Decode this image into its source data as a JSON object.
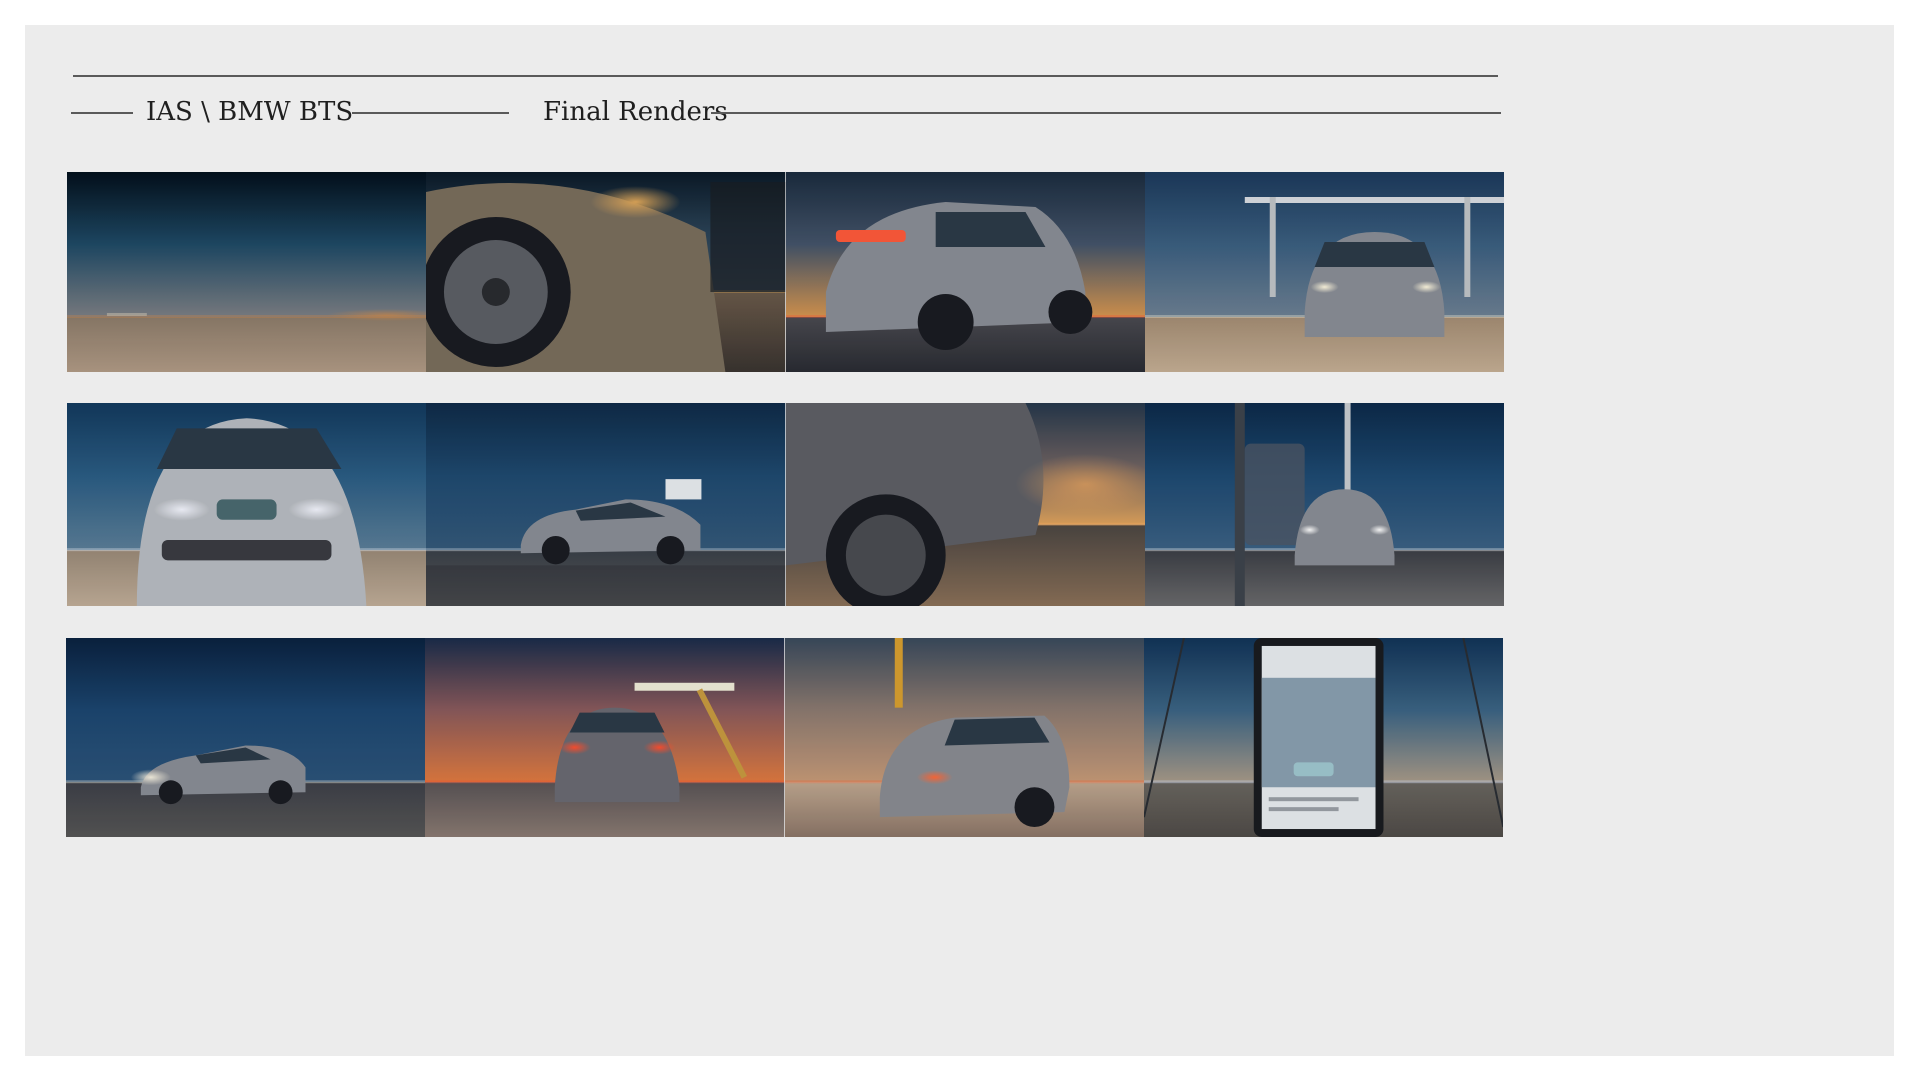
{
  "header": {
    "project_title": "IAS \\ BMW BTS",
    "section_title": "Final Renders"
  },
  "colors": {
    "page_background": "#ececec",
    "rule": "#5a5a5a",
    "text": "#1f1f1f"
  },
  "render_rows": [
    {
      "frames": [
        {
          "subject": "salt-flat horizon at dusk",
          "sky": [
            "#03101c",
            "#1f4a66",
            "#7c7f84"
          ],
          "ground": [
            "#8d7c6a",
            "#b09a85"
          ],
          "glow": "#d08a4a",
          "car": "none"
        },
        {
          "subject": "front wheel and headlight close-up",
          "sky": [
            "#0b1a28",
            "#2a4256",
            "#3f5362"
          ],
          "ground": [
            "#6a5a4a",
            "#3a3430"
          ],
          "glow": "#e0a85a",
          "car": "wheel-closeup"
        },
        {
          "subject": "sedan rear three-quarter at sunset",
          "sky": [
            "#1b2c3f",
            "#44546a",
            "#d69650"
          ],
          "ground": [
            "#4a4a50",
            "#2a2c33"
          ],
          "glow": "#ff5a3a",
          "car": "rear-right"
        },
        {
          "subject": "sedan front under light rig",
          "sky": [
            "#1c3a5c",
            "#3b5f80",
            "#6d8093"
          ],
          "ground": [
            "#a48d74",
            "#c4ae94"
          ],
          "glow": "#fff8e0",
          "car": "front-rig"
        }
      ]
    },
    {
      "frames": [
        {
          "subject": "sedan front with headlights on",
          "sky": [
            "#133a5e",
            "#2b5d84",
            "#5b7e98"
          ],
          "ground": [
            "#9a8a78",
            "#c0ad98"
          ],
          "glow": "#f4f6ff",
          "car": "front-close"
        },
        {
          "subject": "sedan side profile in motion",
          "sky": [
            "#0f2b48",
            "#1f4a70",
            "#34597a"
          ],
          "ground": [
            "#3a4048",
            "#5a5a5a"
          ],
          "glow": "#dfe8f0",
          "car": "side-left"
        },
        {
          "subject": "rear wheel low angle at sunset",
          "sky": [
            "#26384c",
            "#6b6060",
            "#e0a35c"
          ],
          "ground": [
            "#4c4642",
            "#8a7058"
          ],
          "glow": "#ffb060",
          "car": "wheel-low"
        },
        {
          "subject": "sedan on platform beside phone frame",
          "sky": [
            "#0c2a4a",
            "#1e4a72",
            "#3b6184"
          ],
          "ground": [
            "#3c3f46",
            "#6a6a6c"
          ],
          "glow": "#ffffff",
          "car": "front-small"
        }
      ]
    },
    {
      "frames": [
        {
          "subject": "sedan side profile with lens flare",
          "sky": [
            "#0a2240",
            "#1c4670",
            "#2c547a"
          ],
          "ground": [
            "#3e4048",
            "#565656"
          ],
          "glow": "#f5f0e0",
          "car": "side-right"
        },
        {
          "subject": "sedan rear under overhead light",
          "sky": [
            "#1a2c4a",
            "#8a5a5c",
            "#e07a40"
          ],
          "ground": [
            "#5a5456",
            "#8a7a72"
          ],
          "glow": "#ff5030",
          "car": "rear-center"
        },
        {
          "subject": "sedan drifting on salt flat",
          "sky": [
            "#3a4a5c",
            "#8c7a70",
            "#c69a78"
          ],
          "ground": [
            "#c0a890",
            "#8c7668"
          ],
          "glow": "#ff6a3a",
          "car": "rear-drift"
        },
        {
          "subject": "phone screen showing social post",
          "sky": [
            "#123458",
            "#3b6484",
            "#a89a88"
          ],
          "ground": [
            "#6a6660",
            "#504c48"
          ],
          "glow": "#d0e0ff",
          "car": "phone"
        }
      ]
    }
  ]
}
